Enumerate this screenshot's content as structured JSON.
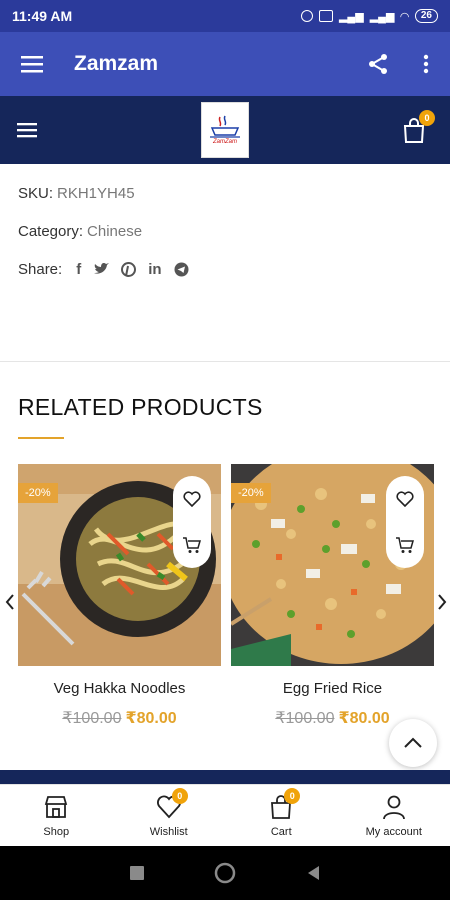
{
  "status": {
    "time": "11:49 AM",
    "battery": "26"
  },
  "appbar": {
    "title": "Zamzam"
  },
  "site": {
    "cart_count": "0",
    "logo_text": "ZamZam"
  },
  "product": {
    "sku_label": "SKU:",
    "sku": "RKH1YH45",
    "category_label": "Category:",
    "category": "Chinese",
    "share_label": "Share:",
    "share_icons": [
      "facebook-icon",
      "twitter-icon",
      "pinterest-icon",
      "linkedin-icon",
      "telegram-icon"
    ]
  },
  "related": {
    "title": "RELATED PRODUCTS",
    "items": [
      {
        "name": "Veg Hakka Noodles",
        "sale": "-20%",
        "old_price": "₹100.00",
        "new_price": "₹80.00"
      },
      {
        "name": "Egg Fried Rice",
        "sale": "-20%",
        "old_price": "₹100.00",
        "new_price": "₹80.00"
      }
    ]
  },
  "bottom_nav": [
    {
      "label": "Shop",
      "icon": "shop-icon"
    },
    {
      "label": "Wishlist",
      "icon": "heart-icon",
      "badge": "0"
    },
    {
      "label": "Cart",
      "icon": "bag-icon",
      "badge": "0"
    },
    {
      "label": "My account",
      "icon": "user-icon"
    }
  ],
  "colors": {
    "appbar": "#3d4fb7",
    "site_header": "#15265a",
    "accent": "#e3a32a"
  }
}
